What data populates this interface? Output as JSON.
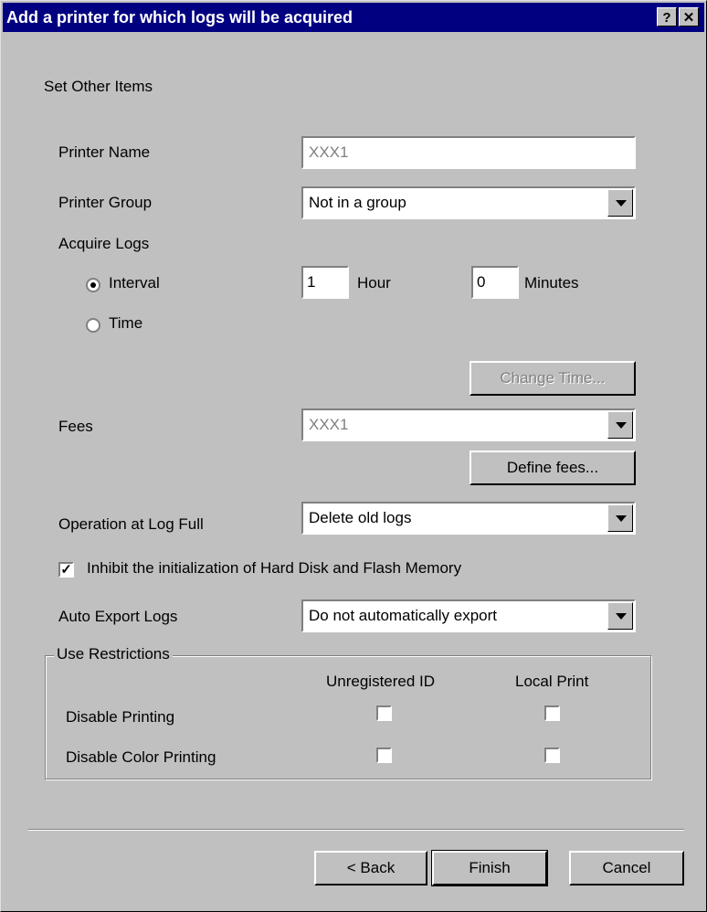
{
  "window": {
    "title": "Add a printer for which logs will be acquired",
    "help_label": "?",
    "close_label": "✕"
  },
  "section_title": "Set Other Items",
  "printer_name": {
    "label": "Printer Name",
    "value": "XXX1"
  },
  "printer_group": {
    "label": "Printer Group",
    "value": "Not in a group"
  },
  "acquire_logs": {
    "label": "Acquire Logs",
    "interval_label": "Interval",
    "time_label": "Time",
    "interval_selected": true,
    "hour_value": "1",
    "hour_unit": "Hour",
    "minutes_value": "0",
    "minutes_unit": "Minutes",
    "change_time_label": "Change Time..."
  },
  "fees": {
    "label": "Fees",
    "value": "XXX1",
    "define_label": "Define fees..."
  },
  "operation_log_full": {
    "label": "Operation at Log Full",
    "value": "Delete old logs"
  },
  "inhibit_init": {
    "label": "Inhibit the initialization of Hard Disk and Flash Memory",
    "checked": true
  },
  "auto_export": {
    "label": "Auto Export Logs",
    "value": "Do not automatically export"
  },
  "use_restrictions": {
    "title": "Use Restrictions",
    "col_unregistered": "Unregistered ID",
    "col_local": "Local Print",
    "row_disable_printing": "Disable Printing",
    "row_disable_color": "Disable Color Printing"
  },
  "buttons": {
    "back": "< Back",
    "finish": "Finish",
    "cancel": "Cancel"
  }
}
